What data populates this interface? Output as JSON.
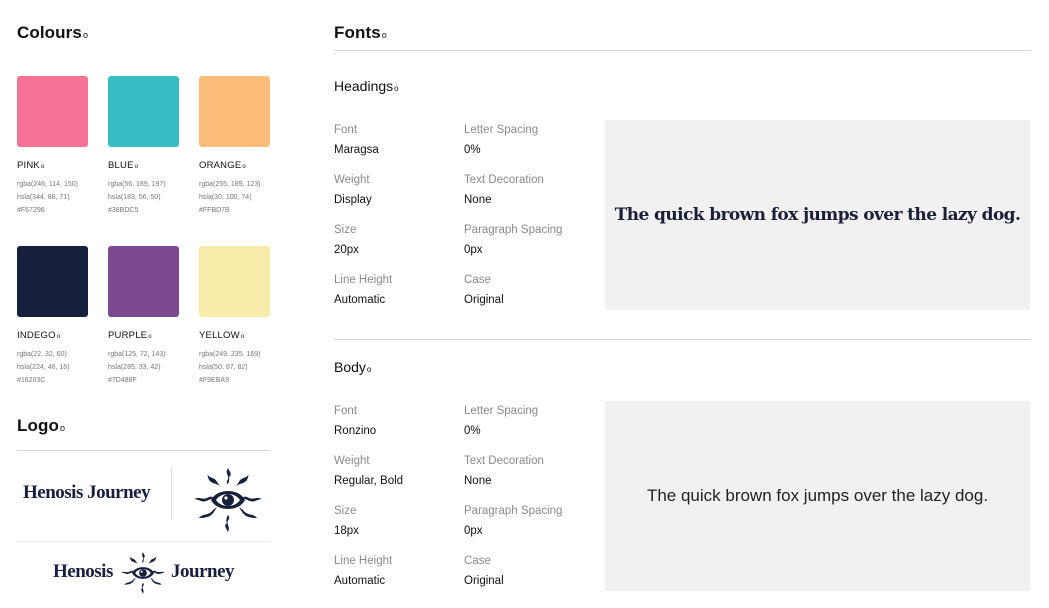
{
  "colours": {
    "title": "Colours",
    "dot": "o",
    "swatches": [
      {
        "name": "PINK",
        "rgba": "rgba(246, 114, 150)",
        "hsla": "hsla(344, 88, 71)",
        "hex": "#F67296",
        "color": "#F67296"
      },
      {
        "name": "BLUE",
        "rgba": "rgba(56, 189, 197)",
        "hsla": "hsla(183, 56, 50)",
        "hex": "#38BDC5",
        "color": "#38BDC5"
      },
      {
        "name": "ORANGE",
        "rgba": "rgba(255, 189, 123)",
        "hsla": "hsla(30, 100, 74)",
        "hex": "#FFBD7B",
        "color": "#FFBD7B"
      },
      {
        "name": "INDEGO",
        "rgba": "rgba(22, 32, 60)",
        "hsla": "hsla(224, 46, 16)",
        "hex": "#16203C",
        "color": "#16203C"
      },
      {
        "name": "PURPLE",
        "rgba": "rgba(125, 72, 143)",
        "hsla": "hsla(285, 33, 42)",
        "hex": "#7D488F",
        "color": "#7D488F"
      },
      {
        "name": "YELLOW",
        "rgba": "rgba(249, 235, 169)",
        "hsla": "hsla(50, 87, 82)",
        "hex": "#F9EBA9",
        "color": "#F9EBA9"
      }
    ]
  },
  "logo": {
    "title": "Logo",
    "brand_word1": "Henosis",
    "brand_word2": "Journey",
    "brand_full": "Henosis Journey",
    "icon": "sun-eye-emblem-icon"
  },
  "fonts": {
    "title": "Fonts",
    "headings": {
      "title": "Headings",
      "font_label": "Font",
      "font": "Maragsa",
      "weight_label": "Weight",
      "weight": "Display",
      "size_label": "Size",
      "size": "20px",
      "line_height_label": "Line Height",
      "line_height": "Automatic",
      "letter_spacing_label": "Letter Spacing",
      "letter_spacing": "0%",
      "text_decoration_label": "Text Decoration",
      "text_decoration": "None",
      "paragraph_spacing_label": "Paragraph Spacing",
      "paragraph_spacing": "0px",
      "case_label": "Case",
      "case": "Original",
      "preview": "The quick brown fox jumps over the lazy dog."
    },
    "body": {
      "title": "Body",
      "font_label": "Font",
      "font": "Ronzino",
      "weight_label": "Weight",
      "weight": "Regular, Bold",
      "size_label": "Size",
      "size": "18px",
      "line_height_label": "Line Height",
      "line_height": "Automatic",
      "letter_spacing_label": "Letter Spacing",
      "letter_spacing": "0%",
      "text_decoration_label": "Text Decoration",
      "text_decoration": "None",
      "paragraph_spacing_label": "Paragraph Spacing",
      "paragraph_spacing": "0px",
      "case_label": "Case",
      "case": "Original",
      "preview": "The quick brown fox jumps over the lazy dog."
    }
  }
}
